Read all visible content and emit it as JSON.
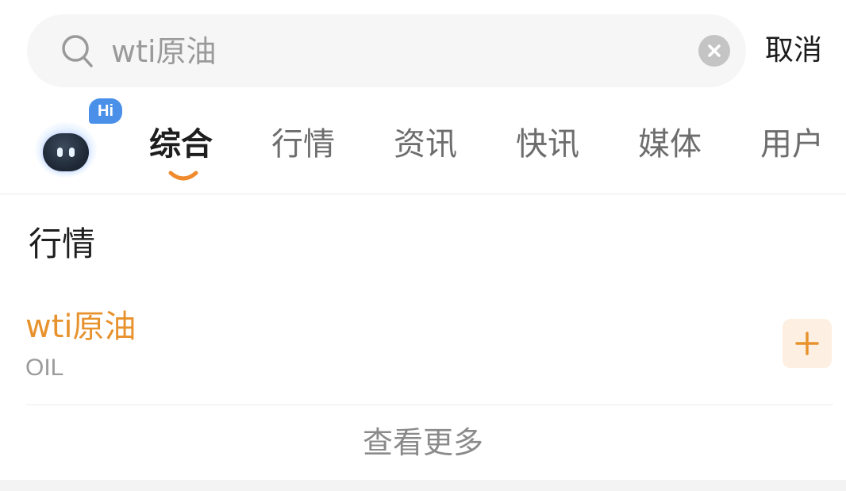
{
  "search": {
    "query": "wti原油",
    "cancel_label": "取消"
  },
  "assistant": {
    "bubble_text": "Hi"
  },
  "tabs": [
    {
      "label": "综合",
      "active": true
    },
    {
      "label": "行情",
      "active": false
    },
    {
      "label": "资讯",
      "active": false
    },
    {
      "label": "快讯",
      "active": false
    },
    {
      "label": "媒体",
      "active": false
    },
    {
      "label": "用户",
      "active": false
    }
  ],
  "section": {
    "title": "行情",
    "items": [
      {
        "name": "wti原油",
        "code": "OIL"
      }
    ],
    "view_more_label": "查看更多"
  },
  "colors": {
    "accent": "#e8922e",
    "tab_indicator": "#f08a2c",
    "add_button_bg": "#fdf0e2",
    "search_bg": "#f6f6f6"
  }
}
